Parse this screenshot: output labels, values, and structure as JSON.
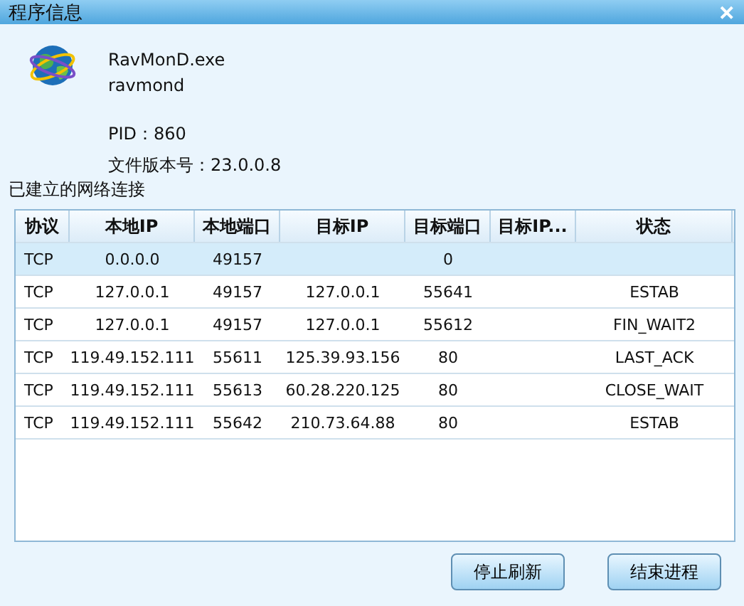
{
  "window": {
    "title": "程序信息",
    "close": "✕"
  },
  "program": {
    "file": "RavMonD.exe",
    "name": "ravmond",
    "pid": "PID：860",
    "version": "文件版本号：23.0.0.8"
  },
  "connections_label": "已建立的网络连接",
  "table": {
    "columns": [
      "协议",
      "本地IP",
      "本地端口",
      "目标IP",
      "目标端口",
      "目标IP...",
      "状态"
    ],
    "rows": [
      {
        "selected": true,
        "cells": [
          "TCP",
          "0.0.0.0",
          "49157",
          "",
          "0",
          "",
          ""
        ]
      },
      {
        "selected": false,
        "cells": [
          "TCP",
          "127.0.0.1",
          "49157",
          "127.0.0.1",
          "55641",
          "",
          "ESTAB"
        ]
      },
      {
        "selected": false,
        "cells": [
          "TCP",
          "127.0.0.1",
          "49157",
          "127.0.0.1",
          "55612",
          "",
          "FIN_WAIT2"
        ]
      },
      {
        "selected": false,
        "cells": [
          "TCP",
          "119.49.152.111",
          "55611",
          "125.39.93.156",
          "80",
          "",
          "LAST_ACK"
        ]
      },
      {
        "selected": false,
        "cells": [
          "TCP",
          "119.49.152.111",
          "55613",
          "60.28.220.125",
          "80",
          "",
          "CLOSE_WAIT"
        ]
      },
      {
        "selected": false,
        "cells": [
          "TCP",
          "119.49.152.111",
          "55642",
          "210.73.64.88",
          "80",
          "",
          "ESTAB"
        ]
      }
    ]
  },
  "buttons": [
    "停止刷新",
    "结束进程"
  ]
}
